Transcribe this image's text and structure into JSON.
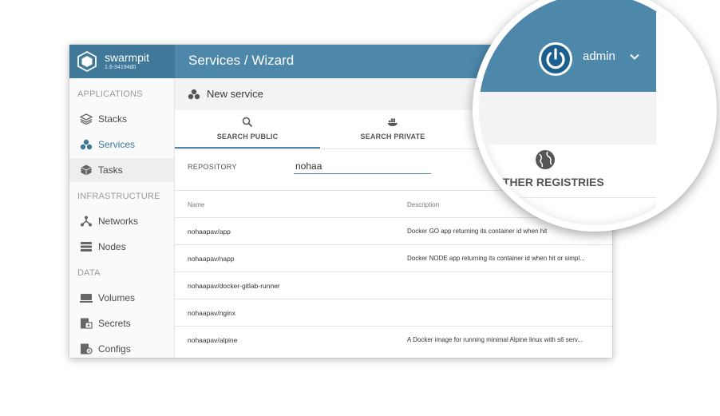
{
  "brand": {
    "name": "swarmpit",
    "version": "1.6-34194d0"
  },
  "header": {
    "title": "Services / Wizard",
    "user": "admin"
  },
  "sidebar": {
    "sections": [
      {
        "title": "APPLICATIONS",
        "items": [
          {
            "label": "Stacks",
            "icon": "stacks-icon"
          },
          {
            "label": "Services",
            "icon": "services-icon",
            "selected": true
          },
          {
            "label": "Tasks",
            "icon": "tasks-icon"
          }
        ]
      },
      {
        "title": "INFRASTRUCTURE",
        "items": [
          {
            "label": "Networks",
            "icon": "networks-icon"
          },
          {
            "label": "Nodes",
            "icon": "nodes-icon"
          }
        ]
      },
      {
        "title": "DATA",
        "items": [
          {
            "label": "Volumes",
            "icon": "volumes-icon"
          },
          {
            "label": "Secrets",
            "icon": "secrets-icon"
          },
          {
            "label": "Configs",
            "icon": "configs-icon"
          }
        ]
      }
    ]
  },
  "subheader": {
    "title": "New service"
  },
  "tabs": [
    {
      "label": "SEARCH PUBLIC",
      "icon": "search-icon",
      "active": true
    },
    {
      "label": "SEARCH PRIVATE",
      "icon": "docker-icon"
    },
    {
      "label": "OTHER REGISTRIES",
      "icon": "globe-icon"
    }
  ],
  "search": {
    "label": "REPOSITORY",
    "value": "nohaa"
  },
  "table": {
    "headers": [
      "Name",
      "Description"
    ],
    "rows": [
      {
        "name": "nohaapav/app",
        "description": "Docker GO app returning its container id when hit"
      },
      {
        "name": "nohaapav/napp",
        "description": "Docker NODE app returning its container id when hit or simpl..."
      },
      {
        "name": "nohaapav/docker-gitlab-runner",
        "description": ""
      },
      {
        "name": "nohaapav/nginx",
        "description": ""
      },
      {
        "name": "nohaapav/alpine",
        "description": "A Docker image for running minimal Alpine linux with s6 serv..."
      }
    ]
  },
  "colors": {
    "primary": "#4d88ab",
    "primary_dark": "#3f7899",
    "active_text": "#3f7899"
  }
}
